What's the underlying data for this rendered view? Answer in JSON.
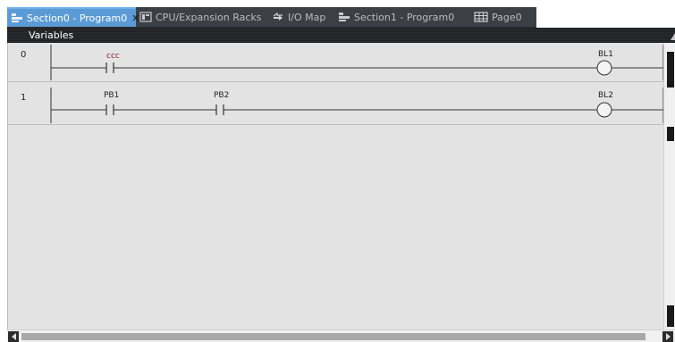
{
  "tabs": [
    {
      "label": "Section0 - Program0",
      "icon": "section-icon",
      "active": true,
      "closable": true
    },
    {
      "label": "CPU/Expansion Racks",
      "icon": "rack-icon",
      "active": false
    },
    {
      "label": "I/O Map",
      "icon": "io-map-icon",
      "active": false
    },
    {
      "label": "Section1 - Program0",
      "icon": "section-icon",
      "active": false
    },
    {
      "label": "Page0",
      "icon": "grid-icon",
      "active": false
    }
  ],
  "variables_bar": {
    "label": "Variables"
  },
  "rungs": [
    {
      "number": "0",
      "contacts": [
        {
          "label": "ccc",
          "label_color": "#8b1a1a"
        }
      ],
      "coil": {
        "label": "BL1"
      }
    },
    {
      "number": "1",
      "contacts": [
        {
          "label": "PB1"
        },
        {
          "label": "PB2"
        }
      ],
      "coil": {
        "label": "BL2"
      }
    }
  ],
  "colors": {
    "active_tab": "#5b9bd5",
    "tab_strip": "#3c3f45",
    "editor_bg": "#e3e3e3"
  }
}
